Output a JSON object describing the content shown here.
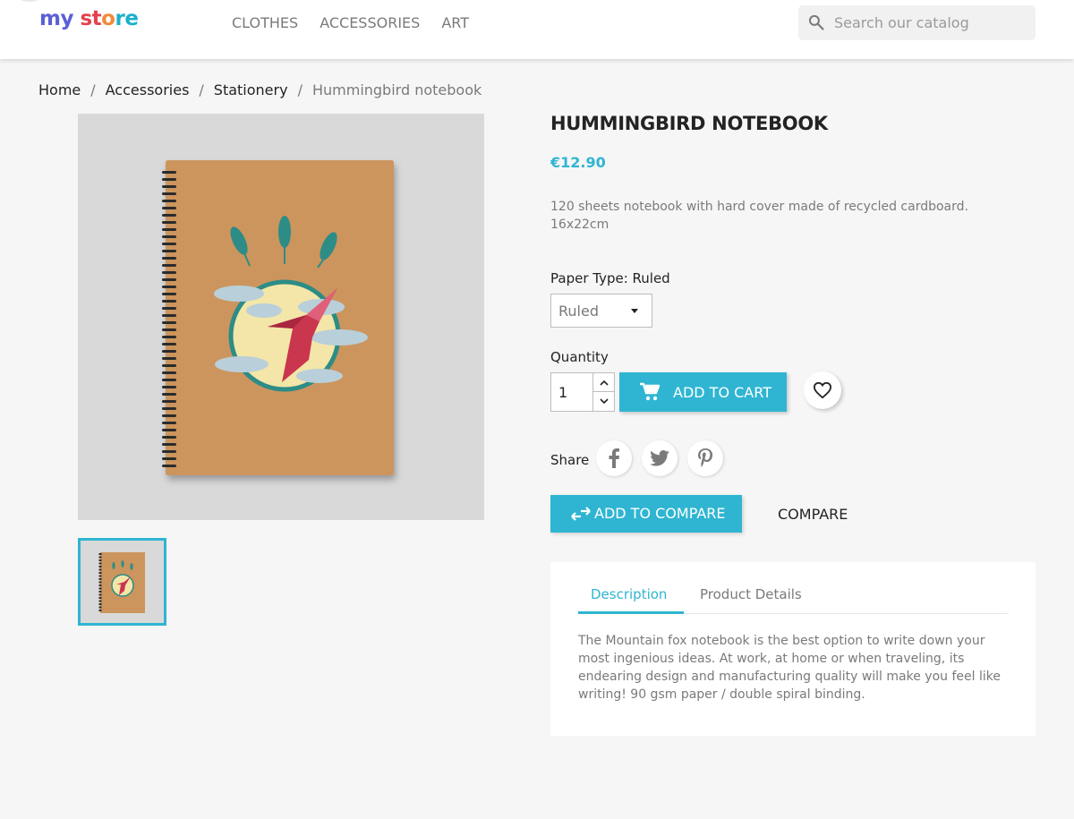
{
  "header": {
    "logo": {
      "part1": "my",
      "part2": "st",
      "part3": "o",
      "part4": "re"
    },
    "nav": [
      "CLOTHES",
      "ACCESSORIES",
      "ART"
    ],
    "search_placeholder": "Search our catalog"
  },
  "breadcrumb": {
    "items": [
      "Home",
      "Accessories",
      "Stationery"
    ],
    "current": "Hummingbird notebook",
    "separator": "/"
  },
  "product": {
    "title": "HUMMINGBIRD NOTEBOOK",
    "price": "€12.90",
    "short_description": "120 sheets notebook with hard cover made of recycled cardboard. 16x22cm",
    "variant_label": "Paper Type: Ruled",
    "variant_value": "Ruled",
    "quantity_label": "Quantity",
    "quantity_value": "1",
    "add_to_cart": "ADD TO CART",
    "share_label": "Share",
    "add_to_compare": "ADD TO COMPARE",
    "compare": "COMPARE"
  },
  "tabs": {
    "description": "Description",
    "product_details": "Product Details",
    "description_text": "The Mountain fox notebook is the best option to write down your most ingenious ideas. At work, at home or when traveling, its endearing design and manufacturing quality will make you feel like writing! 90 gsm paper / double spiral binding."
  },
  "colors": {
    "accent": "#2fb5d2",
    "text": "#232323",
    "muted": "#7a7a7a",
    "background": "#f6f6f6"
  },
  "icons": [
    "search-icon",
    "cart-icon",
    "heart-icon",
    "facebook-icon",
    "twitter-icon",
    "pinterest-icon",
    "compare-icon",
    "chevron-up-icon",
    "chevron-down-icon"
  ]
}
